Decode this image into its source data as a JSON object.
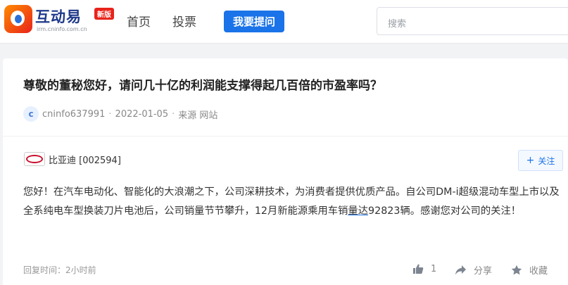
{
  "header": {
    "logo_title": "互动易",
    "logo_sub": "irm.cninfo.com.cn",
    "logo_badge": "新版",
    "nav": {
      "home": "首页",
      "vote": "投票"
    },
    "ask_button": "我要提问",
    "search_placeholder": "搜索"
  },
  "question": {
    "title": "尊敬的董秘您好，请问几十亿的利润能支撑得起几百倍的市盈率吗？",
    "avatar_letter": "c",
    "user": "cninfo637991",
    "date": "2022-01-05",
    "source": "来源 网站"
  },
  "answer": {
    "company": "比亚迪 [002594]",
    "follow_label": "关注",
    "text_before": "您好！在汽车电动化、智能化的大浪潮之下，公司深耕技术，为消费者提供优质产品。自公司DM-i超级混动车型上市以及全系纯电车型换装刀片电池后，公司销量节节攀升，12月新能源乘用车销",
    "text_underlined": "量达",
    "text_after": "92823辆。感谢您对公司的关注！",
    "reply_time": "回复时间：2小时前",
    "likes": "1",
    "share_label": "分享",
    "collect_label": "收藏"
  },
  "colors": {
    "accent": "#1a73e8",
    "brand_red": "#e8231b"
  }
}
